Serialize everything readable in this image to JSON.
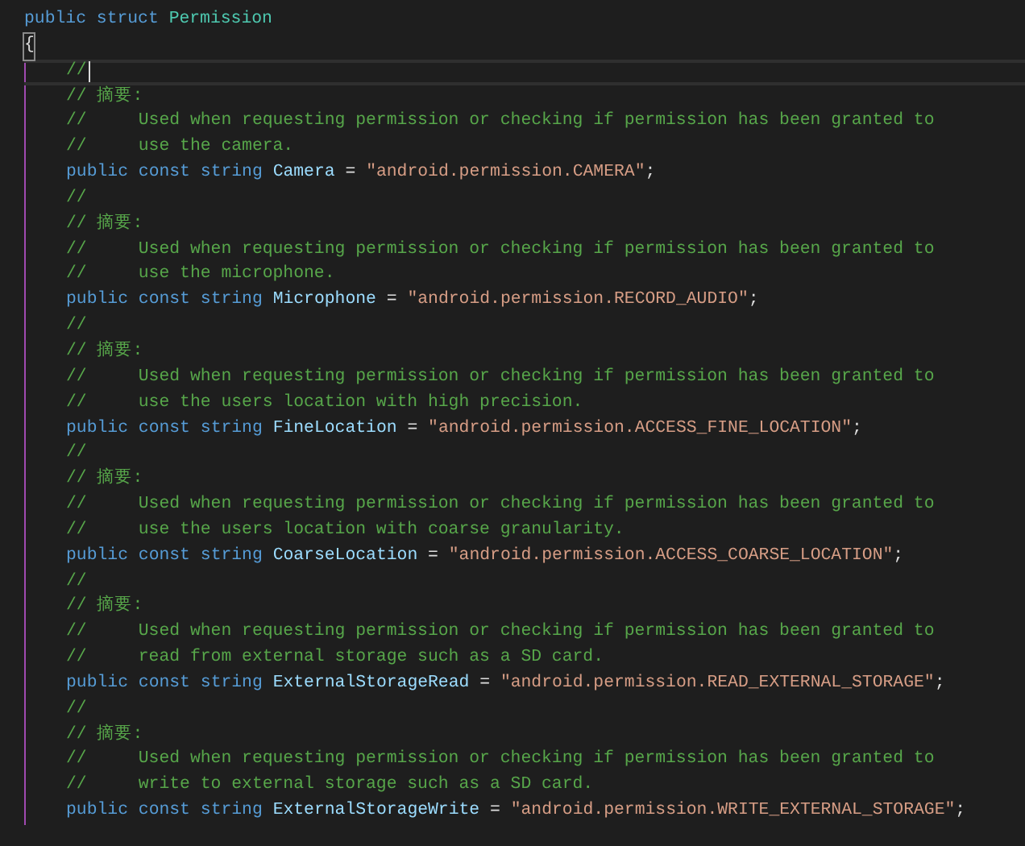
{
  "editor": {
    "declaration": {
      "current": false,
      "tokens": [
        {
          "kind": "keyword",
          "text": "public"
        },
        {
          "kind": "keyword",
          "text": "struct"
        },
        {
          "kind": "type",
          "text": "Permission"
        }
      ]
    },
    "open_brace": {
      "current": false,
      "tokens": [
        {
          "kind": "brace",
          "text": "{"
        }
      ]
    },
    "members": [
      {
        "current": true,
        "tokens": [
          {
            "kind": "comment",
            "text": "//"
          }
        ]
      },
      {
        "current": false,
        "tokens": [
          {
            "kind": "comment",
            "text": "// 摘要:"
          }
        ]
      },
      {
        "current": false,
        "tokens": [
          {
            "kind": "comment",
            "text": "//     Used when requesting permission or checking if permission has been granted to"
          }
        ]
      },
      {
        "current": false,
        "tokens": [
          {
            "kind": "comment",
            "text": "//     use the camera."
          }
        ]
      },
      {
        "current": false,
        "tokens": [
          {
            "kind": "keyword",
            "text": "public"
          },
          {
            "kind": "keyword",
            "text": "const"
          },
          {
            "kind": "keyword",
            "text": "string"
          },
          {
            "kind": "field",
            "text": "Camera"
          },
          {
            "kind": "punct",
            "text": "="
          },
          {
            "kind": "string",
            "text": "\"android.permission.CAMERA\""
          },
          {
            "kind": "punct",
            "text": ";",
            "attach": true
          }
        ]
      },
      {
        "current": false,
        "tokens": [
          {
            "kind": "comment",
            "text": "//"
          }
        ]
      },
      {
        "current": false,
        "tokens": [
          {
            "kind": "comment",
            "text": "// 摘要:"
          }
        ]
      },
      {
        "current": false,
        "tokens": [
          {
            "kind": "comment",
            "text": "//     Used when requesting permission or checking if permission has been granted to"
          }
        ]
      },
      {
        "current": false,
        "tokens": [
          {
            "kind": "comment",
            "text": "//     use the microphone."
          }
        ]
      },
      {
        "current": false,
        "tokens": [
          {
            "kind": "keyword",
            "text": "public"
          },
          {
            "kind": "keyword",
            "text": "const"
          },
          {
            "kind": "keyword",
            "text": "string"
          },
          {
            "kind": "field",
            "text": "Microphone"
          },
          {
            "kind": "punct",
            "text": "="
          },
          {
            "kind": "string",
            "text": "\"android.permission.RECORD_AUDIO\""
          },
          {
            "kind": "punct",
            "text": ";",
            "attach": true
          }
        ]
      },
      {
        "current": false,
        "tokens": [
          {
            "kind": "comment",
            "text": "//"
          }
        ]
      },
      {
        "current": false,
        "tokens": [
          {
            "kind": "comment",
            "text": "// 摘要:"
          }
        ]
      },
      {
        "current": false,
        "tokens": [
          {
            "kind": "comment",
            "text": "//     Used when requesting permission or checking if permission has been granted to"
          }
        ]
      },
      {
        "current": false,
        "tokens": [
          {
            "kind": "comment",
            "text": "//     use the users location with high precision."
          }
        ]
      },
      {
        "current": false,
        "tokens": [
          {
            "kind": "keyword",
            "text": "public"
          },
          {
            "kind": "keyword",
            "text": "const"
          },
          {
            "kind": "keyword",
            "text": "string"
          },
          {
            "kind": "field",
            "text": "FineLocation"
          },
          {
            "kind": "punct",
            "text": "="
          },
          {
            "kind": "string",
            "text": "\"android.permission.ACCESS_FINE_LOCATION\""
          },
          {
            "kind": "punct",
            "text": ";",
            "attach": true
          }
        ]
      },
      {
        "current": false,
        "tokens": [
          {
            "kind": "comment",
            "text": "//"
          }
        ]
      },
      {
        "current": false,
        "tokens": [
          {
            "kind": "comment",
            "text": "// 摘要:"
          }
        ]
      },
      {
        "current": false,
        "tokens": [
          {
            "kind": "comment",
            "text": "//     Used when requesting permission or checking if permission has been granted to"
          }
        ]
      },
      {
        "current": false,
        "tokens": [
          {
            "kind": "comment",
            "text": "//     use the users location with coarse granularity."
          }
        ]
      },
      {
        "current": false,
        "tokens": [
          {
            "kind": "keyword",
            "text": "public"
          },
          {
            "kind": "keyword",
            "text": "const"
          },
          {
            "kind": "keyword",
            "text": "string"
          },
          {
            "kind": "field",
            "text": "CoarseLocation"
          },
          {
            "kind": "punct",
            "text": "="
          },
          {
            "kind": "string",
            "text": "\"android.permission.ACCESS_COARSE_LOCATION\""
          },
          {
            "kind": "punct",
            "text": ";",
            "attach": true
          }
        ]
      },
      {
        "current": false,
        "tokens": [
          {
            "kind": "comment",
            "text": "//"
          }
        ]
      },
      {
        "current": false,
        "tokens": [
          {
            "kind": "comment",
            "text": "// 摘要:"
          }
        ]
      },
      {
        "current": false,
        "tokens": [
          {
            "kind": "comment",
            "text": "//     Used when requesting permission or checking if permission has been granted to"
          }
        ]
      },
      {
        "current": false,
        "tokens": [
          {
            "kind": "comment",
            "text": "//     read from external storage such as a SD card."
          }
        ]
      },
      {
        "current": false,
        "tokens": [
          {
            "kind": "keyword",
            "text": "public"
          },
          {
            "kind": "keyword",
            "text": "const"
          },
          {
            "kind": "keyword",
            "text": "string"
          },
          {
            "kind": "field",
            "text": "ExternalStorageRead"
          },
          {
            "kind": "punct",
            "text": "="
          },
          {
            "kind": "string",
            "text": "\"android.permission.READ_EXTERNAL_STORAGE\""
          },
          {
            "kind": "punct",
            "text": ";",
            "attach": true
          }
        ]
      },
      {
        "current": false,
        "tokens": [
          {
            "kind": "comment",
            "text": "//"
          }
        ]
      },
      {
        "current": false,
        "tokens": [
          {
            "kind": "comment",
            "text": "// 摘要:"
          }
        ]
      },
      {
        "current": false,
        "tokens": [
          {
            "kind": "comment",
            "text": "//     Used when requesting permission or checking if permission has been granted to"
          }
        ]
      },
      {
        "current": false,
        "tokens": [
          {
            "kind": "comment",
            "text": "//     write to external storage such as a SD card."
          }
        ]
      },
      {
        "current": false,
        "tokens": [
          {
            "kind": "keyword",
            "text": "public"
          },
          {
            "kind": "keyword",
            "text": "const"
          },
          {
            "kind": "keyword",
            "text": "string"
          },
          {
            "kind": "field",
            "text": "ExternalStorageWrite"
          },
          {
            "kind": "punct",
            "text": "="
          },
          {
            "kind": "string",
            "text": "\"android.permission.WRITE_EXTERNAL_STORAGE\""
          },
          {
            "kind": "punct",
            "text": ";",
            "attach": true
          }
        ]
      }
    ]
  }
}
